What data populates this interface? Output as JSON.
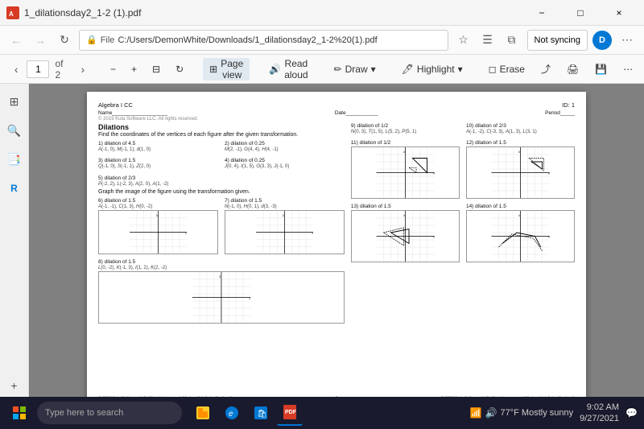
{
  "titlebar": {
    "title": "1_dilationsday2_1-2 (1).pdf",
    "min_label": "−",
    "max_label": "□",
    "close_label": "×"
  },
  "addressbar": {
    "file_label": "File",
    "path": "C:/Users/DemonWhite/Downloads/1_dilationsday2_1-2%20(1).pdf",
    "not_syncing": "Not syncing"
  },
  "pdftoolbar": {
    "page_current": "1",
    "page_total": "of 2",
    "zoom_out": "−",
    "zoom_in": "+",
    "page_view_label": "Page view",
    "read_aloud_label": "Read aloud",
    "draw_label": "Draw",
    "highlight_label": "Highlight",
    "erase_label": "Erase"
  },
  "pdf": {
    "header_left": "Algebra I CC",
    "header_right": "ID: 1",
    "name_label": "Name___________________",
    "date_label": "Date___________",
    "period_label": "Period_____",
    "copyright": "© 2019 Kuta Software LLC. All rights reserved.",
    "main_title": "Dilations",
    "instruction1": "Find the coordinates of the vertices of each figure after the given transformation.",
    "problems": [
      {
        "num": "1)",
        "label": "dilation of 4.5",
        "points": "A(-1, 0), M(-1, 1), d(1, 0)"
      },
      {
        "num": "2)",
        "label": "dilation of 0.25",
        "points": "M(2, -1), G(4, 4), H(4, -1)"
      },
      {
        "num": "3)",
        "label": "dilation of 1.5",
        "points": "Q(-1, 0), S(-1, 1), Z(2, 0)"
      },
      {
        "num": "4)",
        "label": "dilation of 0.25",
        "points": "J(0, 4), I(1, 5), G(3, 3), J(-1, 0)"
      },
      {
        "num": "5)",
        "label": "dilation of 2/3",
        "points": "P(-2, 2), L(-2, 3), A(2, 0), A(1, -2)"
      }
    ],
    "instruction2": "Graph the image of the figure using the transformation given.",
    "graph_problems": [
      {
        "num": "6)",
        "label": "dilation of 1.5",
        "points": "A(-1, -1), C(1, 3), H(0, -2)"
      },
      {
        "num": "7)",
        "label": "dilation of 1.5",
        "points": "N(-1, 0), H(0, 1), d(3, -3)"
      },
      {
        "num": "8)",
        "label": "dilation of 1.5",
        "points": "L(0, -2), K(-1, 3), I(1, 2), K(2, -2)"
      },
      {
        "num": "9)",
        "label": "dilation of 1/2",
        "points": "N(0, 3), T(1, 5), L(5, 2), P(5, 1)"
      },
      {
        "num": "10)",
        "label": "dilation of 2/3",
        "points": "A(-1, -2), C(-3, 3), A(1, 3), L(3, 1)"
      },
      {
        "num": "11)",
        "label": "dilation of 1/2",
        "shape": "triangle_top_right"
      },
      {
        "num": "12)",
        "label": "dilation of 1.5",
        "shape": "triangle_small"
      },
      {
        "num": "13)",
        "label": "dilation of 1.5",
        "shape": "triangle_left"
      },
      {
        "num": "14)",
        "label": "dilation of 1.5",
        "shape": "line_shape"
      }
    ]
  },
  "taskbar": {
    "search_placeholder": "Type here to search",
    "time": "9:02 AM",
    "date": "9/27/2021",
    "weather": "77°F  Mostly sunny"
  }
}
